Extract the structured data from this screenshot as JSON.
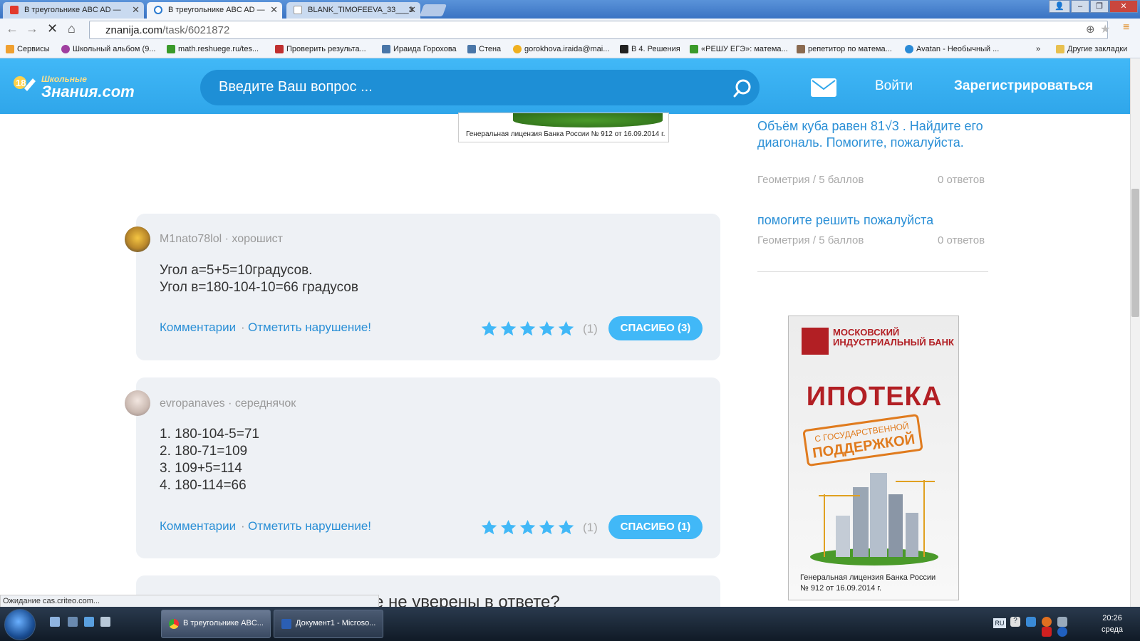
{
  "tabs": [
    {
      "title": "В треугольнике ABC AD — ",
      "active": false
    },
    {
      "title": "В треугольнике ABC AD — ",
      "active": true
    },
    {
      "title": "BLANK_TIMOFEEVA_33___3",
      "active": false
    }
  ],
  "omnibox": {
    "host": "znanija.com",
    "path": "/task/6021872"
  },
  "bookmarks": [
    "Сервисы",
    "Школьный альбом (9...",
    "math.reshuege.ru/tes...",
    "Проверить результа...",
    "Ираида Горохова",
    "Стена",
    "gorokhova.iraida@mai...",
    "В 4. Решения",
    "«РЕШУ ЕГЭ»: матема...",
    "репетитор по матема...",
    "Avatan - Необычный ...",
    "»",
    "Другие закладки"
  ],
  "header": {
    "logo_top": "Школьные",
    "logo_main": "Знания.com",
    "search_placeholder": "Введите Ваш вопрос ...",
    "login": "Войти",
    "register": "Зарегистрироваться"
  },
  "top_ad": {
    "license": "Генеральная лицензия Банка России  № 912 от 16.09.2014 г."
  },
  "answers": [
    {
      "user": "M1nato78lol",
      "rank": "хорошист",
      "text": "Угол а=5+5=10градусов.\nУгол в=180-104-10=66 градусов",
      "comments": "Комментарии",
      "report": "Отметить нарушение!",
      "rating_count": "(1)",
      "thanks": "СПАСИБО (3)",
      "stars": 5
    },
    {
      "user": "evropanaves",
      "rank": "середнячок",
      "text": "1. 180-104-5=71\n2. 180-71=109\n3. 109+5=114\n4. 180-114=66",
      "comments": "Комментарии",
      "report": "Отметить нарушение!",
      "rating_count": "(1)",
      "thanks": "СПАСИБО (1)",
      "stars": 5
    }
  ],
  "third_answer_partial": "е не уверены в ответе?",
  "sidebar": [
    {
      "question": "Объём куба равен 81√3 . Найдите его диагональ. Помогите, пожалуйста.",
      "subject": "Геометрия",
      "points": "5 баллов",
      "answers": "0 ответов"
    },
    {
      "question": "помогите решить пожалуйста",
      "subject": "Геометрия",
      "points": "5 баллов",
      "answers": "0 ответов"
    }
  ],
  "bank_ad": {
    "name": "МОСКОВСКИЙ ИНДУСТРИАЛЬНЫЙ БАНК",
    "headline": "ИПОТЕКА",
    "sub1": "С ГОСУДАРСТВЕННОЙ",
    "sub2": "ПОДДЕРЖКОЙ",
    "license": "Генеральная лицензия Банка России\n№ 912 от 16.09.2014 г."
  },
  "status_bar": "Ожидание cas.criteo.com...",
  "taskbar": {
    "items": [
      "В треугольнике ABC...",
      "Документ1 - Microso..."
    ],
    "lang": "RU",
    "time": "20:26",
    "day": "среда"
  },
  "colors": {
    "brand": "#41b8f7",
    "link": "#2a8fd6",
    "star": "#41b8f7",
    "bank_red": "#b21f24",
    "bank_orange": "#e07b1e"
  }
}
